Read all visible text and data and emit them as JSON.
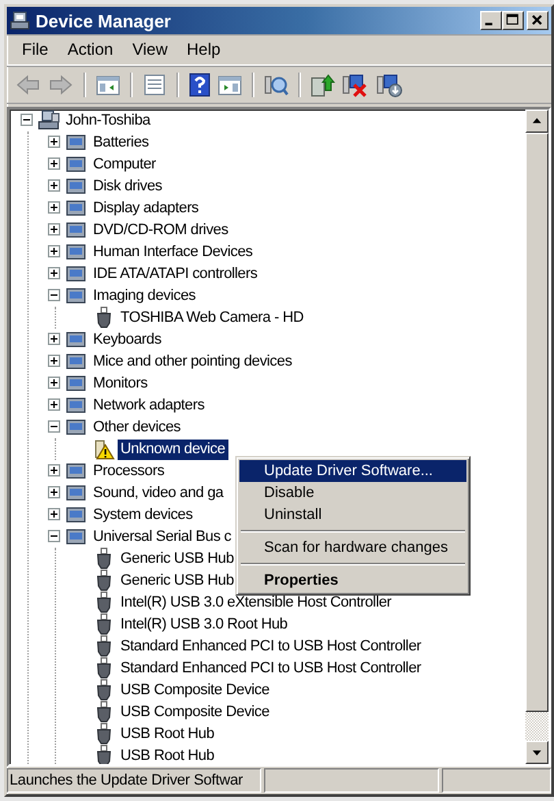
{
  "window": {
    "title": "Device Manager"
  },
  "menu_bar": [
    "File",
    "Action",
    "View",
    "Help"
  ],
  "toolbar": {
    "back": {
      "disabled": true
    },
    "forward": {
      "disabled": true
    }
  },
  "tree": [
    {
      "label": "John-Toshiba",
      "expanded": true,
      "selected": false,
      "warning": false,
      "children": [
        {
          "label": "Batteries",
          "expanded": false,
          "selected": false,
          "warning": false
        },
        {
          "label": "Computer",
          "expanded": false,
          "selected": false,
          "warning": false
        },
        {
          "label": "Disk drives",
          "expanded": false,
          "selected": false,
          "warning": false
        },
        {
          "label": "Display adapters",
          "expanded": false,
          "selected": false,
          "warning": false
        },
        {
          "label": "DVD/CD-ROM drives",
          "expanded": false,
          "selected": false,
          "warning": false
        },
        {
          "label": "Human Interface Devices",
          "expanded": false,
          "selected": false,
          "warning": false
        },
        {
          "label": "IDE ATA/ATAPI controllers",
          "expanded": false,
          "selected": false,
          "warning": false
        },
        {
          "label": "Imaging devices",
          "expanded": true,
          "selected": false,
          "warning": false,
          "children": [
            {
              "label": "TOSHIBA Web Camera - HD",
              "selected": false,
              "warning": false
            }
          ]
        },
        {
          "label": "Keyboards",
          "expanded": false,
          "selected": false,
          "warning": false
        },
        {
          "label": "Mice and other pointing devices",
          "expanded": false,
          "selected": false,
          "warning": false
        },
        {
          "label": "Monitors",
          "expanded": false,
          "selected": false,
          "warning": false
        },
        {
          "label": "Network adapters",
          "expanded": false,
          "selected": false,
          "warning": false
        },
        {
          "label": "Other devices",
          "expanded": true,
          "selected": false,
          "warning": false,
          "children": [
            {
              "label": "Unknown device",
              "selected": true,
              "warning": true
            }
          ]
        },
        {
          "label": "Processors",
          "expanded": false,
          "selected": false,
          "warning": false
        },
        {
          "label": "Sound, video and ga",
          "expanded": false,
          "selected": false,
          "warning": false
        },
        {
          "label": "System devices",
          "expanded": false,
          "selected": false,
          "warning": false
        },
        {
          "label": "Universal Serial Bus c",
          "expanded": true,
          "selected": false,
          "warning": false,
          "children": [
            {
              "label": "Generic USB Hub",
              "selected": false,
              "warning": false
            },
            {
              "label": "Generic USB Hub",
              "selected": false,
              "warning": false
            },
            {
              "label": "Intel(R) USB 3.0 eXtensible Host Controller",
              "selected": false,
              "warning": false
            },
            {
              "label": "Intel(R) USB 3.0 Root Hub",
              "selected": false,
              "warning": false
            },
            {
              "label": "Standard Enhanced PCI to USB Host Controller",
              "selected": false,
              "warning": false
            },
            {
              "label": "Standard Enhanced PCI to USB Host Controller",
              "selected": false,
              "warning": false
            },
            {
              "label": "USB Composite Device",
              "selected": false,
              "warning": false
            },
            {
              "label": "USB Composite Device",
              "selected": false,
              "warning": false
            },
            {
              "label": "USB Root Hub",
              "selected": false,
              "warning": false
            },
            {
              "label": "USB Root Hub",
              "selected": false,
              "warning": false
            }
          ]
        }
      ]
    }
  ],
  "context_menu": [
    {
      "kind": "item",
      "label": "Update Driver Software...",
      "selected": true,
      "default": false
    },
    {
      "kind": "item",
      "label": "Disable",
      "selected": false,
      "default": false
    },
    {
      "kind": "item",
      "label": "Uninstall",
      "selected": false,
      "default": false
    },
    {
      "kind": "separator"
    },
    {
      "kind": "item",
      "label": "Scan for hardware changes",
      "selected": false,
      "default": false
    },
    {
      "kind": "separator"
    },
    {
      "kind": "item",
      "label": "Properties",
      "selected": false,
      "default": true
    }
  ],
  "status_bar": {
    "text": "Launches the Update Driver Softwar"
  }
}
